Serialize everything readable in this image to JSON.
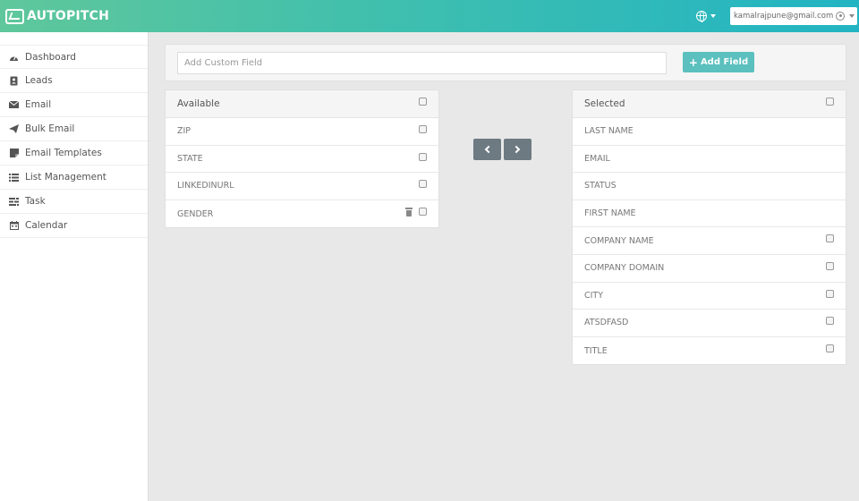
{
  "app": {
    "brand": "AUTOPITCH",
    "user_email": "kamalrajpune@gmail.com",
    "colors": {
      "header_start": "#5fc79b",
      "header_end": "#22b4c3",
      "add_button": "#5bc0be",
      "arrow_button": "#6d7a82"
    }
  },
  "sidebar": {
    "items": [
      {
        "label": "Dashboard",
        "icon": "dashboard-icon"
      },
      {
        "label": "Leads",
        "icon": "contact-card-icon"
      },
      {
        "label": "Email",
        "icon": "envelope-icon"
      },
      {
        "label": "Bulk Email",
        "icon": "paper-plane-icon"
      },
      {
        "label": "Email Templates",
        "icon": "sticky-note-icon"
      },
      {
        "label": "List Management",
        "icon": "list-icon"
      },
      {
        "label": "Task",
        "icon": "tasks-icon"
      },
      {
        "label": "Calendar",
        "icon": "calendar-icon"
      }
    ]
  },
  "custom_field": {
    "placeholder": "Add Custom Field",
    "value": "",
    "add_label": "Add Field"
  },
  "available": {
    "title": "Available",
    "items": [
      "ZIP",
      "STATE",
      "LINKEDINURL",
      "GENDER"
    ]
  },
  "selected": {
    "title": "Selected",
    "items": [
      "LAST NAME",
      "EMAIL",
      "STATUS",
      "FIRST NAME",
      "COMPANY NAME",
      "COMPANY DOMAIN",
      "CITY",
      "ATSDFASD",
      "TITLE"
    ]
  }
}
